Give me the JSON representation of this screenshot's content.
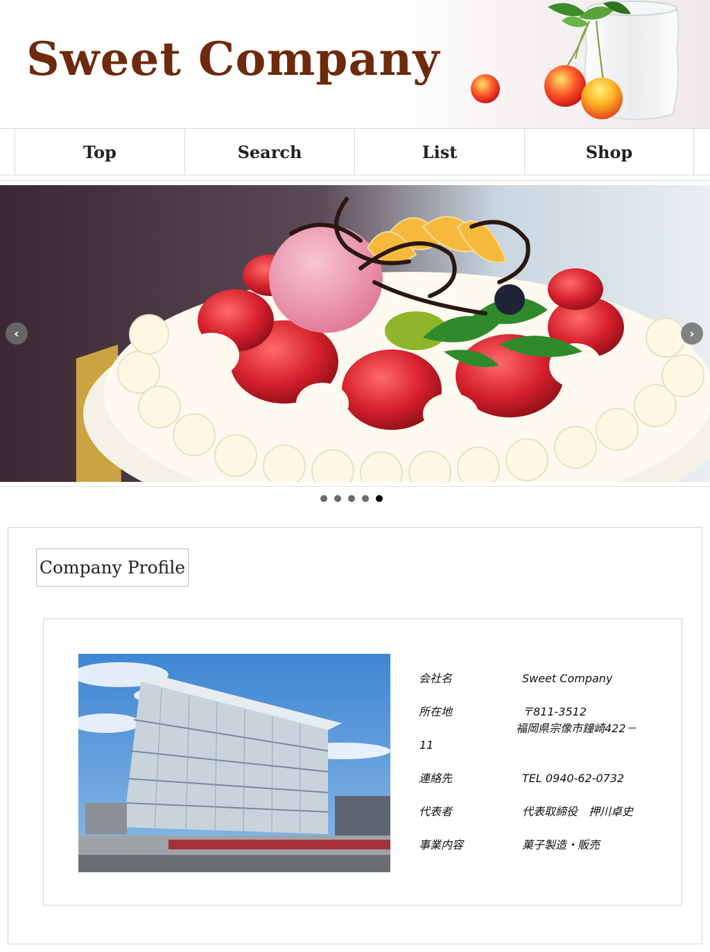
{
  "header": {
    "site_title": "Sweet Company"
  },
  "nav": {
    "items": [
      {
        "label": "Top"
      },
      {
        "label": "Search"
      },
      {
        "label": "List"
      },
      {
        "label": "Shop"
      }
    ]
  },
  "slider": {
    "prev_icon": "chevron-left-icon",
    "next_icon": "chevron-right-icon",
    "prev_glyph": "‹",
    "next_glyph": "›",
    "slide_count": 5,
    "active_index": 4
  },
  "profile": {
    "section_title": "Company Profile",
    "rows": [
      {
        "label": "会社名",
        "value": "Sweet Company"
      },
      {
        "label": "所在地",
        "value_line1": "〒811-3512",
        "value_line2": "福岡県宗像市鐘崎422－",
        "value_line3": "11"
      },
      {
        "label": "連絡先",
        "value": "TEL 0940-62-0732"
      },
      {
        "label": "代表者",
        "value": "代表取締役　押川卓史"
      },
      {
        "label": "事業内容",
        "value": "菓子製造・販売"
      }
    ]
  },
  "colors": {
    "title_brown": "#6e2a0c",
    "border_gray": "#d3d3d3",
    "dot_active": "#000000",
    "dot_inactive": "#6a6a6a"
  }
}
